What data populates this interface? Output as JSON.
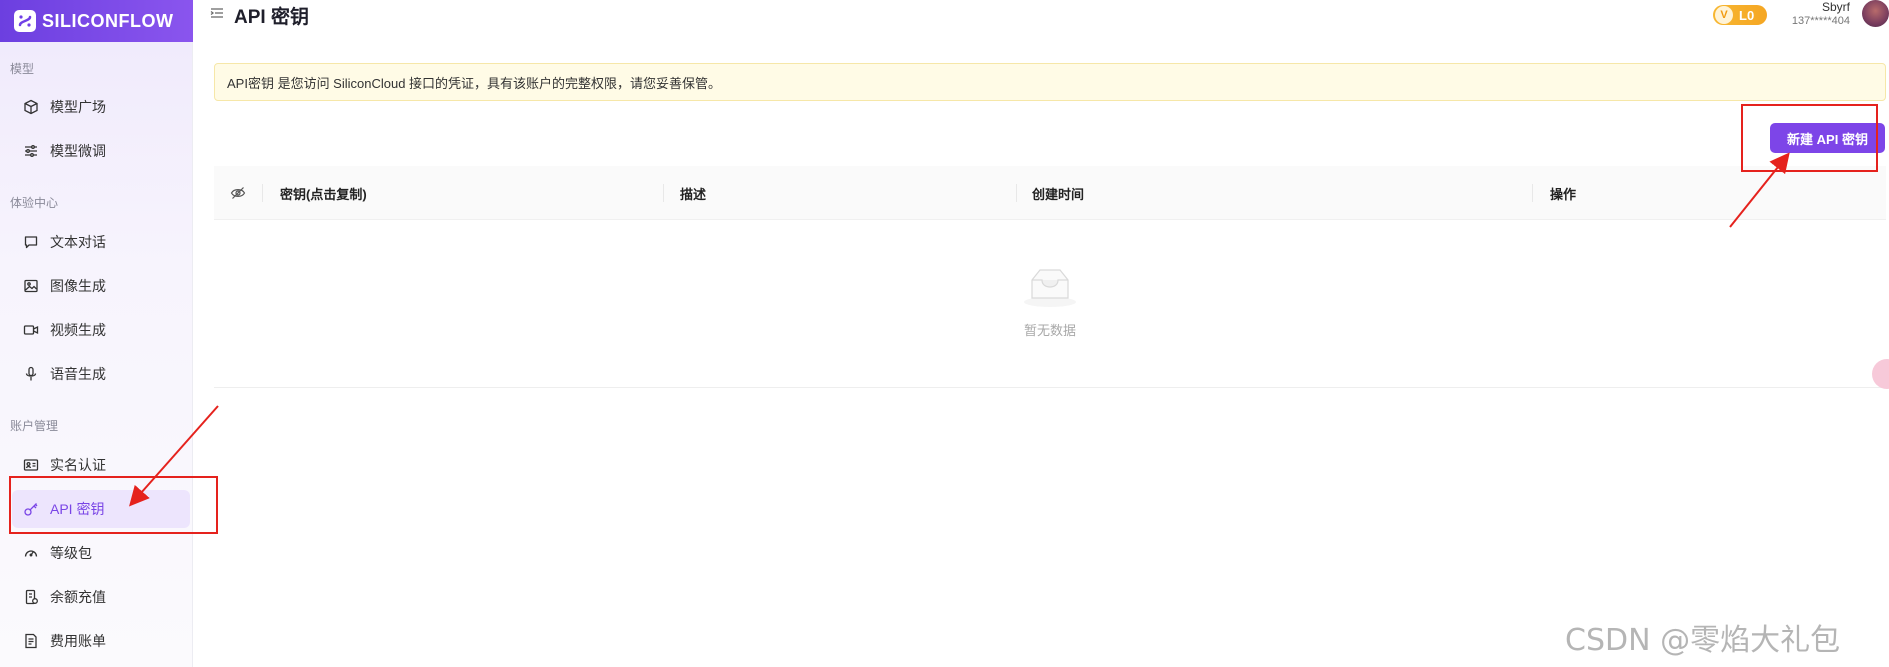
{
  "brand": {
    "name": "SILICONFLOW",
    "accent": "#7d45e8"
  },
  "page": {
    "title": "API 密钥"
  },
  "user": {
    "name": "Sbyrf",
    "phone": "137*****404",
    "level": "L0",
    "level_icon": "V"
  },
  "sidebar": {
    "sections": [
      {
        "title": "模型"
      },
      {
        "title": "体验中心"
      },
      {
        "title": "账户管理"
      }
    ],
    "items": [
      {
        "label": "模型广场",
        "icon": "cube-icon"
      },
      {
        "label": "模型微调",
        "icon": "sliders-icon"
      },
      {
        "label": "文本对话",
        "icon": "chat-icon"
      },
      {
        "label": "图像生成",
        "icon": "image-icon"
      },
      {
        "label": "视频生成",
        "icon": "video-icon"
      },
      {
        "label": "语音生成",
        "icon": "mic-icon"
      },
      {
        "label": "实名认证",
        "icon": "id-card-icon"
      },
      {
        "label": "API 密钥",
        "icon": "key-icon",
        "active": true
      },
      {
        "label": "等级包",
        "icon": "gauge-icon"
      },
      {
        "label": "余额充值",
        "icon": "recharge-icon"
      },
      {
        "label": "费用账单",
        "icon": "bill-icon"
      }
    ]
  },
  "notice": {
    "text": "API密钥 是您访问 SiliconCloud 接口的凭证，具有该账户的完整权限，请您妥善保管。"
  },
  "toolbar": {
    "create_label": "新建 API 密钥"
  },
  "table": {
    "columns": [
      "密钥(点击复制)",
      "描述",
      "创建时间",
      "操作"
    ],
    "empty_text": "暂无数据"
  },
  "watermark": "CSDN @零焰大礼包"
}
